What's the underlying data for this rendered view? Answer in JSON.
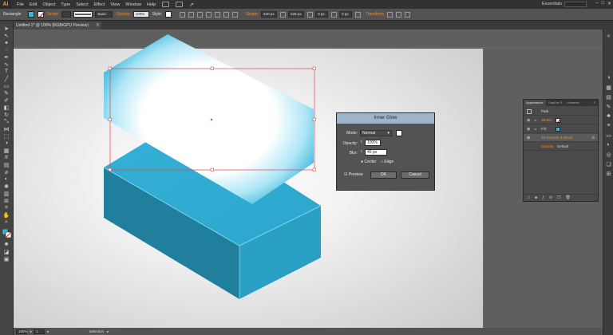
{
  "app": {
    "logo": "Ai",
    "menu": [
      "File",
      "Edit",
      "Object",
      "Type",
      "Select",
      "Effect",
      "View",
      "Window",
      "Help"
    ],
    "workspace": "Essentials",
    "window_controls": [
      "–",
      "□",
      "✕"
    ]
  },
  "control_bar": {
    "object_type": "Rectangle",
    "fill_color": "#39b6d8",
    "stroke_label": "Stroke:",
    "stroke_style": "Basic",
    "opacity_label": "Opacity:",
    "opacity_value": "100%",
    "style_label": "Style:",
    "shape_label": "Shape:",
    "width_value": "640 px",
    "height_value": "526 px",
    "x_value": "0 px",
    "y_value": "0 px",
    "transform_label": "Transform"
  },
  "document": {
    "tab_title": "Untitled-1* @ 100% (RGB/GPU Preview)",
    "close": "✕"
  },
  "status_bar": {
    "zoom": "100%",
    "page": "1",
    "tool": "Selection"
  },
  "appearance_panel": {
    "tabs": [
      "Appearance",
      "Graphic S",
      "Libraries"
    ],
    "object": "Path",
    "rows": [
      {
        "label": "Stroke:",
        "value": ""
      },
      {
        "label": "Fill:",
        "value": ""
      },
      {
        "label": "3D Extrude & Bevel",
        "value": "fx"
      },
      {
        "label": "Opacity:",
        "value": "Default"
      }
    ]
  },
  "dialog": {
    "title": "Inner Glow",
    "mode_label": "Mode:",
    "mode_value": "Normal",
    "opacity_label": "Opacity:",
    "opacity_value": "100%",
    "blur_label": "Blur:",
    "blur_value": "40 px",
    "center_label": "Center",
    "edge_label": "Edge",
    "preview_label": "Preview",
    "ok_label": "OK",
    "cancel_label": "Cancel"
  }
}
